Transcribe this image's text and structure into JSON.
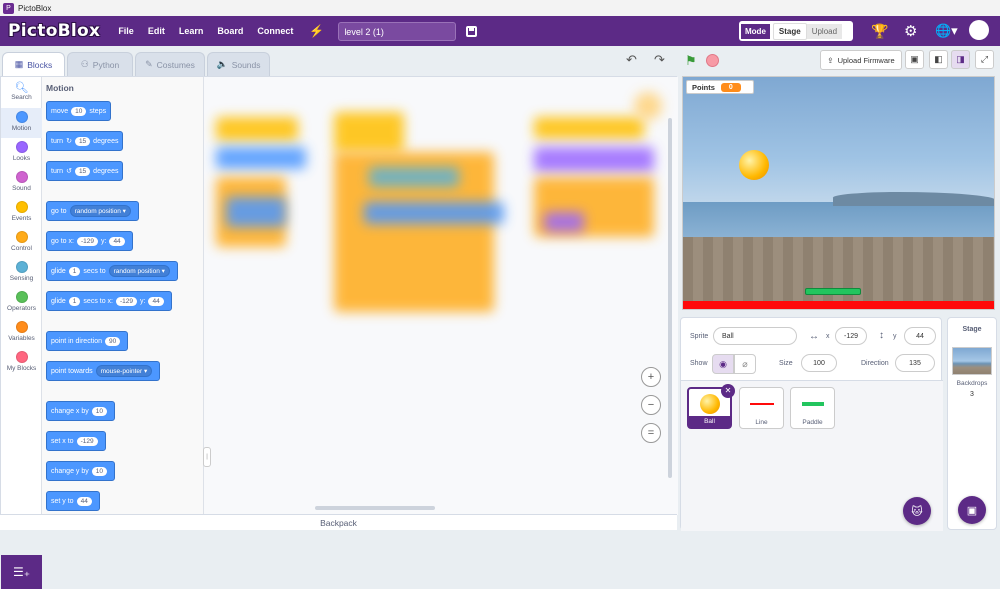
{
  "window": {
    "title": "PictoBlox"
  },
  "menubar": {
    "logo": "PictoBlox",
    "items": [
      "File",
      "Edit",
      "Learn",
      "Board",
      "Connect"
    ],
    "project_name": "level 2 (1)",
    "mode_label": "Mode",
    "mode_stage": "Stage",
    "mode_upload": "Upload"
  },
  "tabs": [
    {
      "label": "Blocks",
      "icon": "blocks-icon"
    },
    {
      "label": "Python",
      "icon": "python-icon"
    },
    {
      "label": "Costumes",
      "icon": "brush-icon"
    },
    {
      "label": "Sounds",
      "icon": "speaker-icon"
    }
  ],
  "categories": [
    {
      "label": "Search",
      "color": "#4c97ff"
    },
    {
      "label": "Motion",
      "color": "#4c97ff"
    },
    {
      "label": "Looks",
      "color": "#9966ff"
    },
    {
      "label": "Sound",
      "color": "#cf63cf"
    },
    {
      "label": "Events",
      "color": "#ffbf00"
    },
    {
      "label": "Control",
      "color": "#ffab19"
    },
    {
      "label": "Sensing",
      "color": "#5cb1d6"
    },
    {
      "label": "Operators",
      "color": "#59c059"
    },
    {
      "label": "Variables",
      "color": "#ff8c1a"
    },
    {
      "label": "My Blocks",
      "color": "#ff6680"
    }
  ],
  "palette": {
    "title": "Motion",
    "blocks": {
      "move": {
        "pre": "move",
        "val": "10",
        "post": "steps"
      },
      "turn_cw": {
        "pre": "turn",
        "val": "15",
        "post": "degrees"
      },
      "turn_ccw": {
        "pre": "turn",
        "val": "15",
        "post": "degrees"
      },
      "goto": {
        "pre": "go to",
        "drop": "random position"
      },
      "gotoxy": {
        "pre": "go to x:",
        "x": "-129",
        "mid": "y:",
        "y": "44"
      },
      "glide_to": {
        "pre": "glide",
        "val": "1",
        "mid": "secs to",
        "drop": "random position"
      },
      "glide_xy": {
        "pre": "glide",
        "val": "1",
        "mid": "secs to x:",
        "x": "-129",
        "ylabel": "y:",
        "y": "44"
      },
      "point_dir": {
        "pre": "point in direction",
        "val": "90"
      },
      "point_towards": {
        "pre": "point towards",
        "drop": "mouse-pointer"
      },
      "change_x": {
        "pre": "change x by",
        "val": "10"
      },
      "set_x": {
        "pre": "set x to",
        "val": "-129"
      },
      "change_y": {
        "pre": "change y by",
        "val": "10"
      },
      "set_y": {
        "pre": "set y to",
        "val": "44"
      }
    }
  },
  "backpack": {
    "label": "Backpack"
  },
  "stage_toolbar": {
    "upload_firmware": "Upload Firmware"
  },
  "stage": {
    "points_label": "Points",
    "points_value": "0"
  },
  "sprite_info": {
    "sprite_label": "Sprite",
    "sprite_name": "Ball",
    "x_label": "x",
    "x_value": "-129",
    "y_label": "y",
    "y_value": "44",
    "show_label": "Show",
    "size_label": "Size",
    "size_value": "100",
    "direction_label": "Direction",
    "direction_value": "135"
  },
  "sprites": [
    {
      "name": "Ball"
    },
    {
      "name": "Line"
    },
    {
      "name": "Paddle"
    }
  ],
  "stage_panel": {
    "title": "Stage",
    "backdrops_label": "Backdrops",
    "backdrops_count": "3"
  },
  "colors": {
    "brand": "#5c2a86",
    "motion": "#4c97ff"
  }
}
